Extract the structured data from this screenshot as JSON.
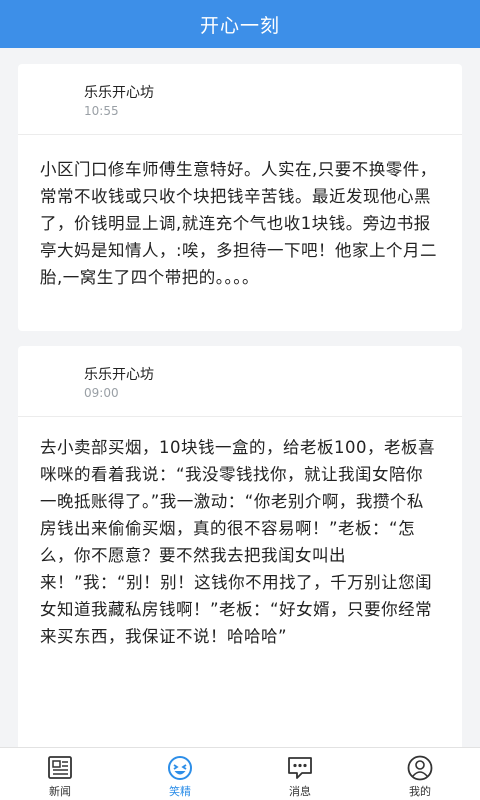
{
  "header": {
    "title": "开心一刻"
  },
  "posts": [
    {
      "author": "乐乐开心坊",
      "time": "10:55",
      "text": "小区门口修车师傅生意特好。人实在,只要不换零件，常常不收钱或只收个块把钱辛苦钱。最近发现他心黑了，价钱明显上调,就连充个气也收1块钱。旁边书报亭大妈是知情人，:唉，多担待一下吧！他家上个月二胎,一窝生了四个带把的。。。。"
    },
    {
      "author": "乐乐开心坊",
      "time": "09:00",
      "text": "去小卖部买烟，10块钱一盒的，给老板100，老板喜咪咪的看着我说：“我没零钱找你，就让我闺女陪你一晚抵账得了。”我一激动：“你老别介啊，我攒个私房钱出来偷偷买烟，真的很不容易啊！”老板：“怎么，你不愿意？要不然我去把我闺女叫出\n来！”我：“别！别！这钱你不用找了，千万别让您闺女知道我藏私房钱啊！”老板：“好女婿，只要你经常来买东西，我保证不说！哈哈哈”"
    }
  ],
  "tabs": [
    {
      "label": "新闻",
      "icon": "newspaper-icon",
      "active": false
    },
    {
      "label": "笑精",
      "icon": "laughing-face-icon",
      "active": true
    },
    {
      "label": "消息",
      "icon": "message-bubble-icon",
      "active": false
    },
    {
      "label": "我的",
      "icon": "user-icon",
      "active": false
    }
  ],
  "colors": {
    "header": "#3d8fe8",
    "active_tab": "#2d8ee8"
  }
}
